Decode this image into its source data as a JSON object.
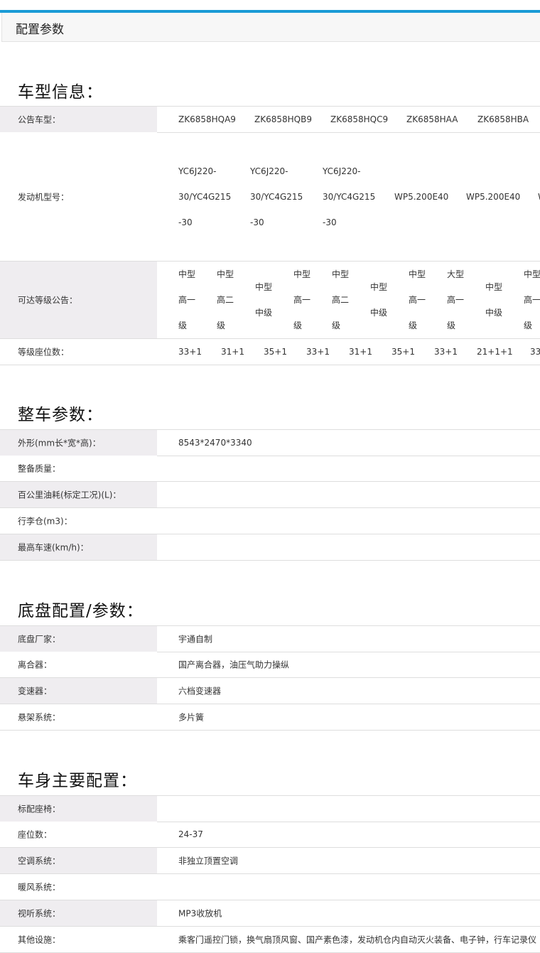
{
  "tab": {
    "title": "配置参数"
  },
  "sections": {
    "vehicle_info": "车型信息：",
    "whole_vehicle": "整车参数：",
    "chassis": "底盘配置/参数：",
    "body": "车身主要配置："
  },
  "vehicle_info": {
    "model_label": "公告车型：",
    "models": [
      "ZK6858HQA9",
      "ZK6858HQB9",
      "ZK6858HQC9",
      "ZK6858HAA",
      "ZK6858HBA"
    ],
    "engine_label": "发动机型号：",
    "engines": [
      [
        "YC6J220-",
        "30/YC4G215",
        "-30"
      ],
      [
        "YC6J220-",
        "30/YC4G215",
        "-30"
      ],
      [
        "YC6J220-",
        "30/YC4G215",
        "-30"
      ],
      [
        "WP5.200E40"
      ],
      [
        "WP5.200E40"
      ],
      [
        "W"
      ]
    ],
    "grade_label": "可达等级公告：",
    "grades": [
      [
        "中型",
        "高一",
        "级"
      ],
      [
        "中型",
        "高二",
        "级"
      ],
      [
        "中型",
        "中级"
      ],
      [
        "中型",
        "高一",
        "级"
      ],
      [
        "中型",
        "高二",
        "级"
      ],
      [
        "中型",
        "中级"
      ],
      [
        "中型",
        "高一",
        "级"
      ],
      [
        "大型",
        "高一",
        "级"
      ],
      [
        "中型",
        "中级"
      ],
      [
        "中型",
        "高一",
        "级"
      ]
    ],
    "seat_label": "等级座位数：",
    "seats": [
      "33+1",
      "31+1",
      "35+1",
      "33+1",
      "31+1",
      "35+1",
      "33+1",
      "21+1+1",
      "33"
    ]
  },
  "whole_vehicle": [
    {
      "label": "外形(mm长*宽*高)：",
      "value": "8543*2470*3340"
    },
    {
      "label": "整备质量：",
      "value": ""
    },
    {
      "label": "百公里油耗(标定工况)(L)：",
      "value": ""
    },
    {
      "label": "行李仓(m3)：",
      "value": ""
    },
    {
      "label": "最高车速(km/h)：",
      "value": ""
    }
  ],
  "chassis": [
    {
      "label": "底盘厂家：",
      "value": "宇通自制"
    },
    {
      "label": "离合器：",
      "value": "国产离合器，油压气助力操纵"
    },
    {
      "label": "变速器：",
      "value": "六档变速器"
    },
    {
      "label": "悬架系统：",
      "value": "多片簧"
    }
  ],
  "body": [
    {
      "label": "标配座椅：",
      "value": ""
    },
    {
      "label": "座位数：",
      "value": "24-37"
    },
    {
      "label": "空调系统：",
      "value": "非独立顶置空调"
    },
    {
      "label": "暖风系统：",
      "value": ""
    },
    {
      "label": "视听系统：",
      "value": "MP3收放机"
    },
    {
      "label": "其他设施：",
      "value": "乘客门遥控门锁，换气扇顶风窗、国产素色漆，发动机仓内自动灭火装备、电子钟，行车记录仪"
    }
  ]
}
